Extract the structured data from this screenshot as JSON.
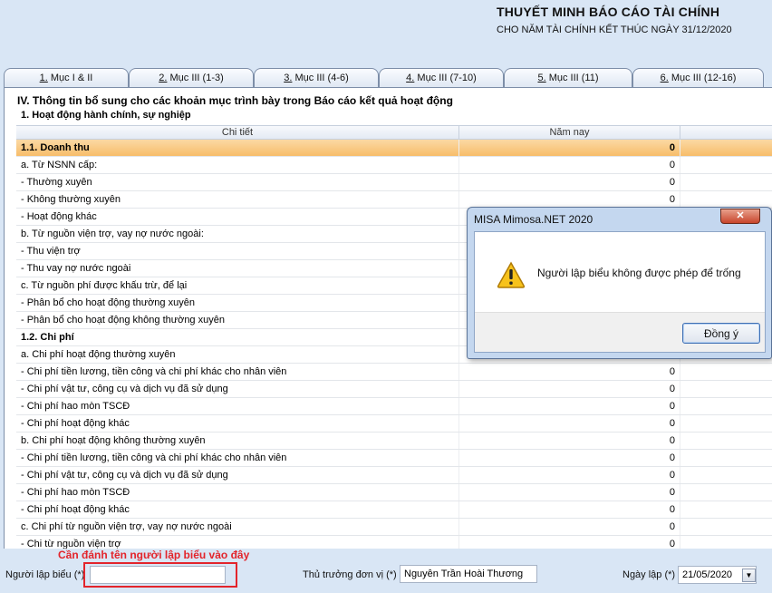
{
  "header": {
    "title": "THUYẾT MINH BÁO CÁO TÀI CHÍNH",
    "subtitle": "CHO NĂM TÀI CHÍNH KẾT THÚC NGÀY 31/12/2020"
  },
  "tabs": [
    {
      "key": "1.",
      "label": " Mục I & II"
    },
    {
      "key": "2.",
      "label": " Mục III (1-3)"
    },
    {
      "key": "3.",
      "label": " Mục III (4-6)"
    },
    {
      "key": "4.",
      "label": " Mục III (7-10)"
    },
    {
      "key": "5.",
      "label": " Mục III (11)"
    },
    {
      "key": "6.",
      "label": " Mục III (12-16)"
    }
  ],
  "section": {
    "title": "IV. Thông tin bổ sung cho các khoản mục trình bày trong Báo cáo kết quả hoạt động",
    "subtitle": "1. Hoạt động hành chính, sự nghiệp"
  },
  "table": {
    "columns": {
      "detail": "Chi tiết",
      "this_year": "Năm nay"
    },
    "rows": [
      {
        "label": "1.1. Doanh thu",
        "value": "0"
      },
      {
        "label": "a. Từ NSNN cấp:",
        "value": "0"
      },
      {
        "label": "- Thường xuyên",
        "value": "0"
      },
      {
        "label": "- Không thường xuyên",
        "value": "0"
      },
      {
        "label": "- Hoạt động khác",
        "value": ""
      },
      {
        "label": "b. Từ nguồn viện trợ, vay nợ nước ngoài:",
        "value": ""
      },
      {
        "label": "- Thu viện trợ",
        "value": ""
      },
      {
        "label": "- Thu vay nợ nước ngoài",
        "value": ""
      },
      {
        "label": "c. Từ nguồn phí được khấu trừ, để lại",
        "value": ""
      },
      {
        "label": "- Phân bổ cho hoạt động thường xuyên",
        "value": ""
      },
      {
        "label": "- Phân bổ cho hoạt động không thường xuyên",
        "value": ""
      },
      {
        "label": "1.2. Chi phí",
        "value": ""
      },
      {
        "label": "a. Chi phí hoạt động thường xuyên",
        "value": ""
      },
      {
        "label": "- Chi phí tiền lương, tiền công và chi phí khác cho nhân viên",
        "value": "0"
      },
      {
        "label": "- Chi phí vật tư, công cụ và dịch vụ đã sử dụng",
        "value": "0"
      },
      {
        "label": "- Chi phí hao mòn TSCĐ",
        "value": "0"
      },
      {
        "label": "- Chi phí hoạt động khác",
        "value": "0"
      },
      {
        "label": "b. Chi phí hoạt động không thường xuyên",
        "value": "0"
      },
      {
        "label": "- Chi phí tiền lương, tiền công và chi phí khác cho nhân viên",
        "value": "0"
      },
      {
        "label": "- Chi phí vật tư, công cụ và dịch vụ đã sử dụng",
        "value": "0"
      },
      {
        "label": "- Chi phí hao mòn TSCĐ",
        "value": "0"
      },
      {
        "label": "- Chi phí hoạt động khác",
        "value": "0"
      },
      {
        "label": "c. Chi phí từ nguồn viện trợ, vay nợ nước ngoài",
        "value": "0"
      },
      {
        "label": "- Chi từ nguồn viện trợ",
        "value": "0"
      }
    ]
  },
  "footer": {
    "annotation": "Cần đánh tên người lập biểu vào đây",
    "preparer_label": "Người lập biểu (*)",
    "preparer_value": "",
    "head_label": "Thủ trưởng đơn vị (*)",
    "head_value": "Nguyễn Trần Hoài Thương",
    "date_label": "Ngày lập (*)",
    "date_value": "21/05/2020"
  },
  "dialog": {
    "title": "MISA Mimosa.NET 2020",
    "message": "Người lập biểu không được phép để trống",
    "ok_label": "Đồng ý",
    "close_symbol": "✕",
    "icon": "warning-icon"
  },
  "colors": {
    "accent_group_row": "#f7bd6a",
    "annotation_red": "#e3242b",
    "background": "#d9e6f5"
  }
}
